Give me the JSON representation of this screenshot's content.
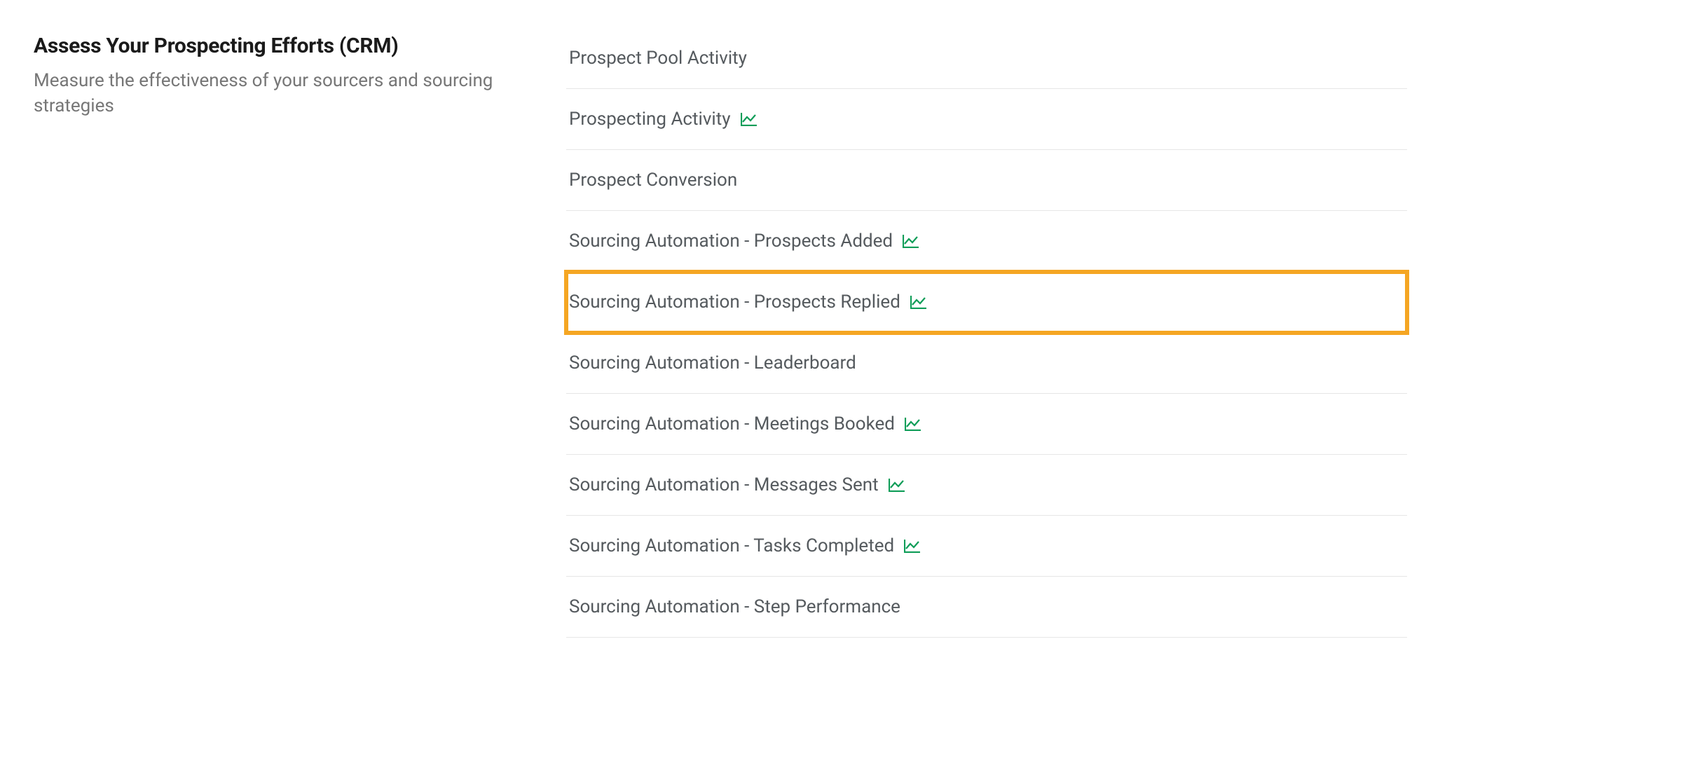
{
  "section": {
    "title": "Assess Your Prospecting Efforts (CRM)",
    "subtitle": "Measure the effectiveness of your sourcers and sourcing strategies"
  },
  "reports": [
    {
      "label": "Prospect Pool Activity",
      "hasChart": false,
      "highlighted": false
    },
    {
      "label": "Prospecting Activity",
      "hasChart": true,
      "highlighted": false
    },
    {
      "label": "Prospect Conversion",
      "hasChart": false,
      "highlighted": false
    },
    {
      "label": "Sourcing Automation - Prospects Added",
      "hasChart": true,
      "highlighted": false
    },
    {
      "label": "Sourcing Automation - Prospects Replied",
      "hasChart": true,
      "highlighted": true
    },
    {
      "label": "Sourcing Automation - Leaderboard",
      "hasChart": false,
      "highlighted": false
    },
    {
      "label": "Sourcing Automation - Meetings Booked",
      "hasChart": true,
      "highlighted": false
    },
    {
      "label": "Sourcing Automation - Messages Sent",
      "hasChart": true,
      "highlighted": false
    },
    {
      "label": "Sourcing Automation - Tasks Completed",
      "hasChart": true,
      "highlighted": false
    },
    {
      "label": "Sourcing Automation - Step Performance",
      "hasChart": false,
      "highlighted": false
    }
  ]
}
